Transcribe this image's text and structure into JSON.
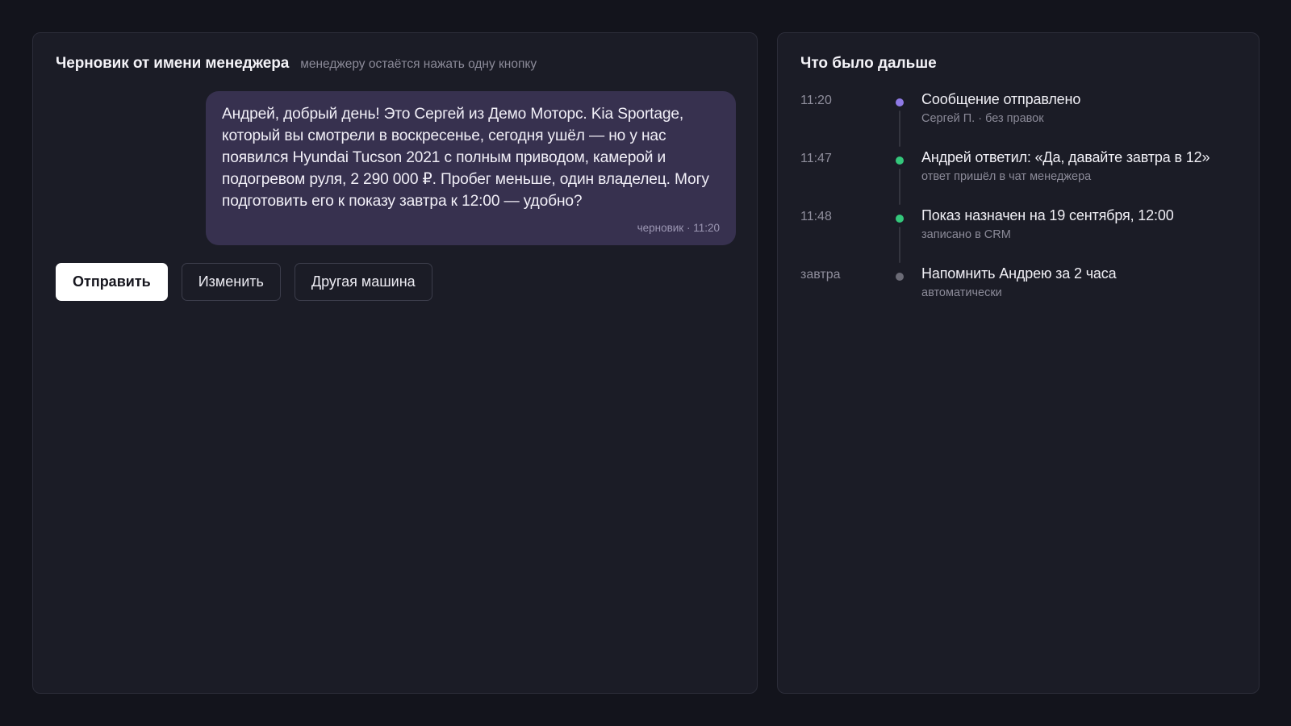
{
  "draft_panel": {
    "title": "Черновик от имени менеджера",
    "subtitle": "менеджеру остаётся нажать одну кнопку",
    "message": {
      "text": "Андрей, добрый день! Это Сергей из Демо Моторс. Kia Sportage, который вы смотрели в воскресенье, сегодня ушёл — но у нас появился Hyundai Tucson 2021 с полным приводом, камерой и подогревом руля, 2 290 000 ₽. Пробег меньше, один владелец. Могу подготовить его к показу завтра к 12:00 — удобно?",
      "meta": "черновик · 11:20"
    },
    "buttons": {
      "send": "Отправить",
      "edit": "Изменить",
      "other_car": "Другая машина"
    }
  },
  "timeline_panel": {
    "title": "Что было дальше",
    "events": [
      {
        "time": "11:20",
        "title": "Сообщение отправлено",
        "subtitle": "Сергей П. · без правок",
        "dot_color": "#8f7ae6"
      },
      {
        "time": "11:47",
        "title": "Андрей ответил: «Да, давайте завтра в 12»",
        "subtitle": "ответ пришёл в чат менеджера",
        "dot_color": "#34c77b"
      },
      {
        "time": "11:48",
        "title": "Показ назначен на 19 сентября, 12:00",
        "subtitle": "записано в CRM",
        "dot_color": "#34c77b"
      },
      {
        "time": "завтра",
        "title": "Напомнить Андрею за 2 часа",
        "subtitle": "автоматически",
        "dot_color": "#6b6b76"
      }
    ]
  },
  "colors": {
    "background": "#13141c",
    "panel": "#1b1c26",
    "bubble": "#37314f",
    "accent_purple": "#8f7ae6",
    "status_green": "#34c77b",
    "status_gray": "#6b6b76"
  }
}
